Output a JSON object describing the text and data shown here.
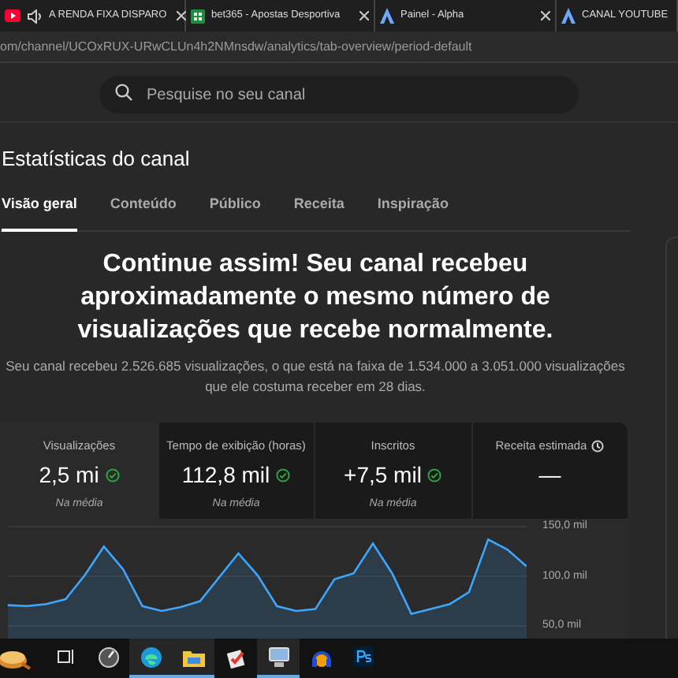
{
  "browser_tabs": [
    {
      "audio": true,
      "title": "A RENDA FIXA DISPARO"
    },
    {
      "audio": false,
      "title": "bet365 - Apostas Desportiva"
    },
    {
      "audio": false,
      "title": "Painel - Alpha"
    },
    {
      "audio": false,
      "title": "CANAL YOUTUBE"
    }
  ],
  "address": "om/channel/UCOxRUX-URwCLUn4h2NMnsdw/analytics/tab-overview/period-default",
  "search": {
    "placeholder": "Pesquise no seu canal"
  },
  "page_title": "Estatísticas do canal",
  "tabs": [
    {
      "label": "Visão geral",
      "selected": true
    },
    {
      "label": "Conteúdo",
      "selected": false
    },
    {
      "label": "Público",
      "selected": false
    },
    {
      "label": "Receita",
      "selected": false
    },
    {
      "label": "Inspiração",
      "selected": false
    }
  ],
  "headline": "Continue assim! Seu canal recebeu aproximadamente o mesmo número de visualizações que recebe normalmente.",
  "summary": "Seu canal recebeu 2.526.685 visualizações, o que está na faixa de 1.534.000 a 3.051.000 visualizações que ele costuma receber em 28 dias.",
  "metrics": [
    {
      "label": "Visualizações",
      "value": "2,5 mi",
      "ok": true,
      "note": "Na média",
      "selected": true,
      "info": false
    },
    {
      "label": "Tempo de exibição (horas)",
      "value": "112,8 mil",
      "ok": true,
      "note": "Na média",
      "selected": false,
      "info": false
    },
    {
      "label": "Inscritos",
      "value": "+7,5 mil",
      "ok": true,
      "note": "Na média",
      "selected": false,
      "info": false
    },
    {
      "label": "Receita estimada",
      "value": "—",
      "ok": false,
      "selected": false,
      "info": true
    }
  ],
  "chart_data": {
    "type": "area",
    "grid": true,
    "ylim": [
      50,
      150
    ],
    "yticks": [
      {
        "value": 50,
        "label": "50,0 mil"
      },
      {
        "value": 100,
        "label": "100,0 mil"
      },
      {
        "value": 150,
        "label": "150,0 mil"
      }
    ],
    "series": [
      {
        "color": "#3ea6ff",
        "values": [
          71,
          70,
          72,
          77,
          101,
          130,
          107,
          70,
          65,
          69,
          75,
          99,
          123,
          101,
          70,
          65,
          67,
          97,
          103,
          133,
          103,
          62,
          67,
          72,
          84,
          137,
          127,
          110
        ]
      }
    ]
  },
  "taskbar": [
    {
      "selected": false
    },
    {
      "selected": false
    },
    {
      "selected": false
    },
    {
      "selected": true
    },
    {
      "selected": true
    },
    {
      "selected": false
    },
    {
      "selected": true
    },
    {
      "selected": false
    },
    {
      "selected": false
    }
  ]
}
